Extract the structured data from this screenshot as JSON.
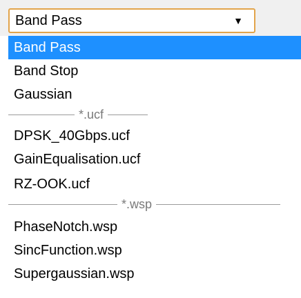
{
  "select": {
    "value": "Band Pass",
    "arrow_icon": "triangle-down"
  },
  "options": {
    "band_pass": "Band Pass",
    "band_stop": "Band Stop",
    "gaussian": "Gaussian",
    "sep_ucf": "*.ucf",
    "dpsk": "DPSK_40Gbps.ucf",
    "gain_eq": "GainEqualisation.ucf",
    "rz_ook": "RZ-OOK.ucf",
    "sep_wsp": "*.wsp",
    "phase_notch": "PhaseNotch.wsp",
    "sinc": "SincFunction.wsp",
    "supergaussian": "Supergaussian.wsp"
  },
  "colors": {
    "selected_bg": "#1e90ff",
    "select_border": "#e2a44a"
  }
}
